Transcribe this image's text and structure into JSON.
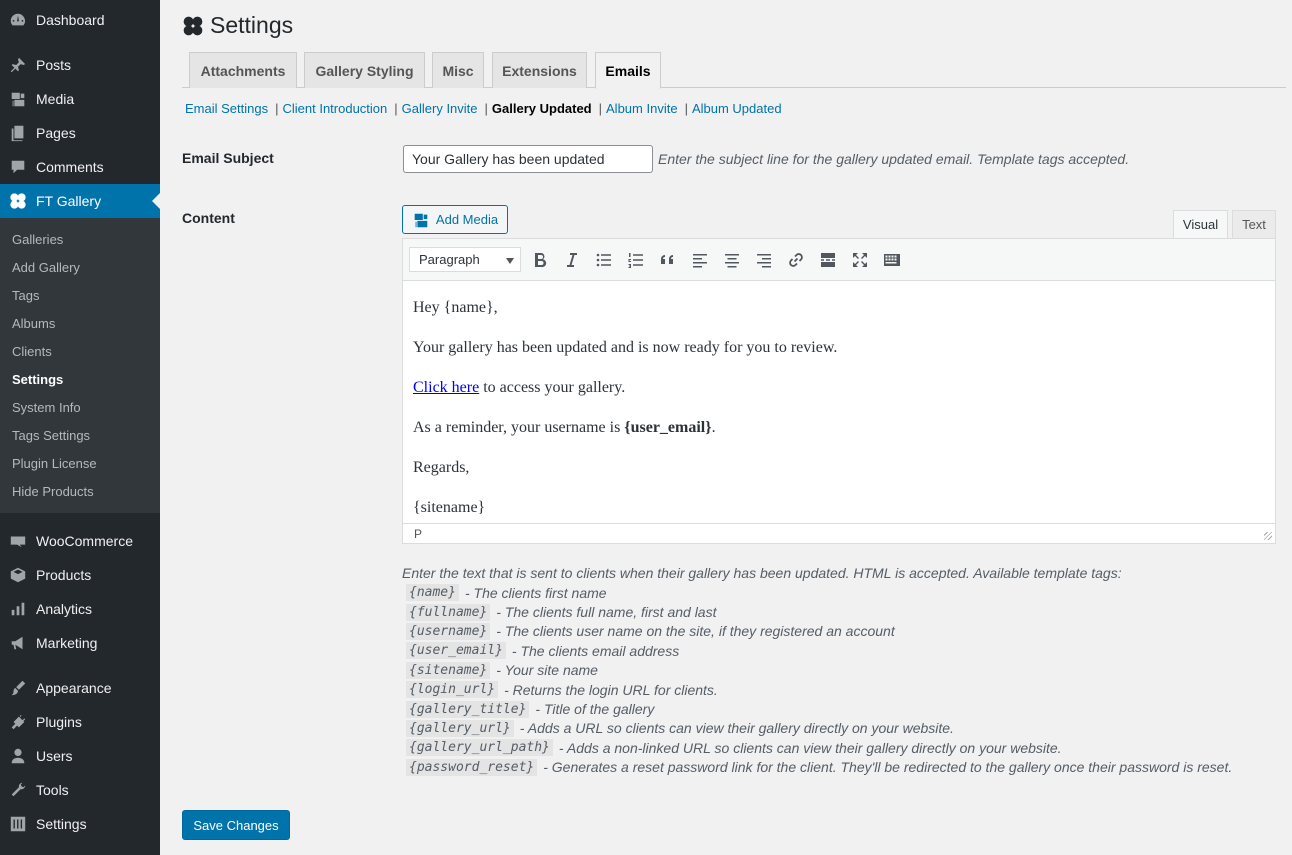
{
  "sidebar": {
    "top_items": [
      {
        "label": "Dashboard",
        "icon": "dashboard-icon"
      },
      {
        "label": "Posts",
        "icon": "pin-icon"
      },
      {
        "label": "Media",
        "icon": "media-icon"
      },
      {
        "label": "Pages",
        "icon": "pages-icon"
      },
      {
        "label": "Comments",
        "icon": "comments-icon"
      },
      {
        "label": "FT Gallery",
        "icon": "ft-gallery-icon"
      }
    ],
    "submenu": [
      "Galleries",
      "Add Gallery",
      "Tags",
      "Albums",
      "Clients",
      "Settings",
      "System Info",
      "Tags Settings",
      "Plugin License",
      "Hide Products"
    ],
    "bottom_items": [
      {
        "label": "WooCommerce",
        "icon": "woocommerce-icon"
      },
      {
        "label": "Products",
        "icon": "products-icon"
      },
      {
        "label": "Analytics",
        "icon": "analytics-icon"
      },
      {
        "label": "Marketing",
        "icon": "marketing-icon"
      },
      {
        "label": "Appearance",
        "icon": "appearance-icon"
      },
      {
        "label": "Plugins",
        "icon": "plugins-icon"
      },
      {
        "label": "Users",
        "icon": "users-icon"
      },
      {
        "label": "Tools",
        "icon": "tools-icon"
      },
      {
        "label": "Settings",
        "icon": "settings-icon"
      }
    ],
    "active_color": "#0073aa"
  },
  "page": {
    "title": "Settings"
  },
  "tabs": [
    "Attachments",
    "Gallery Styling",
    "Misc",
    "Extensions",
    "Emails"
  ],
  "subnav": [
    "Email Settings",
    "Client Introduction",
    "Gallery Invite",
    "Gallery Updated",
    "Album Invite",
    "Album Updated"
  ],
  "form": {
    "subject_label": "Email Subject",
    "subject_value": "Your Gallery has been updated",
    "subject_desc": "Enter the subject line for the gallery updated email. Template tags accepted.",
    "content_label": "Content",
    "add_media": "Add Media",
    "mode_visual": "Visual",
    "mode_text": "Text",
    "format_select": "Paragraph",
    "status_path": "P"
  },
  "editor": {
    "greeting": "Hey {name},",
    "line1": "Your gallery has been updated and is now ready for you to review.",
    "link_text": "Click here",
    "link_rest": " to access your gallery.",
    "reminder_pre": "As a reminder, your username is ",
    "reminder_tag": "{user_email}",
    "reminder_post": ".",
    "regards": "Regards,",
    "sitename": "{sitename}"
  },
  "content_desc": "Enter the text that is sent to clients when their gallery has been updated. HTML is accepted. Available template tags:",
  "template_tags": [
    {
      "tag": "{name}",
      "desc": "- The clients first name"
    },
    {
      "tag": "{fullname}",
      "desc": "- The clients full name, first and last"
    },
    {
      "tag": "{username}",
      "desc": "- The clients user name on the site, if they registered an account"
    },
    {
      "tag": "{user_email}",
      "desc": "- The clients email address"
    },
    {
      "tag": "{sitename}",
      "desc": "- Your site name"
    },
    {
      "tag": "{login_url}",
      "desc": "- Returns the login URL for clients."
    },
    {
      "tag": "{gallery_title}",
      "desc": "- Title of the gallery"
    },
    {
      "tag": "{gallery_url}",
      "desc": "- Adds a URL so clients can view their gallery directly on your website."
    },
    {
      "tag": "{gallery_url_path}",
      "desc": "- Adds a non-linked URL so clients can view their gallery directly on your website."
    },
    {
      "tag": "{password_reset}",
      "desc": "- Generates a reset password link for the client. They'll be redirected to the gallery once their password is reset."
    }
  ],
  "save_button": "Save Changes"
}
